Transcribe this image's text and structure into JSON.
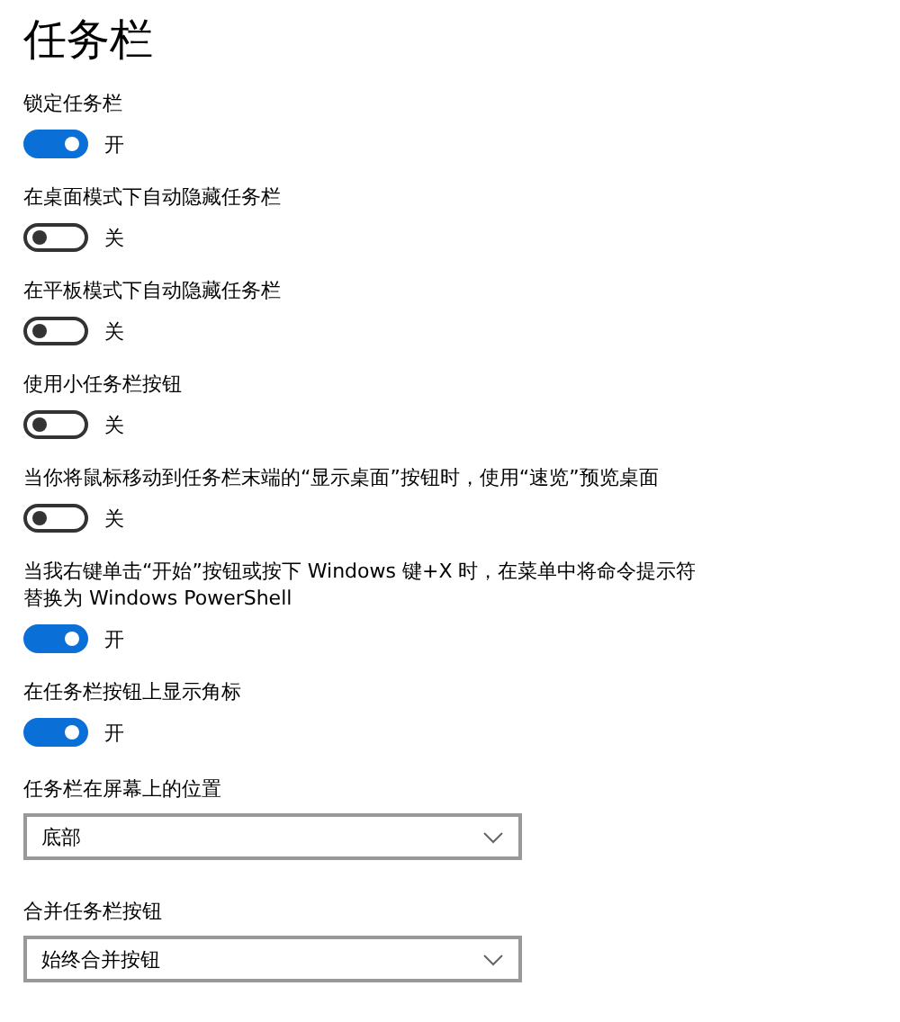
{
  "title": "任务栏",
  "toggles": [
    {
      "label": "锁定任务栏",
      "on": true,
      "state_label": "开"
    },
    {
      "label": "在桌面模式下自动隐藏任务栏",
      "on": false,
      "state_label": "关"
    },
    {
      "label": "在平板模式下自动隐藏任务栏",
      "on": false,
      "state_label": "关"
    },
    {
      "label": "使用小任务栏按钮",
      "on": false,
      "state_label": "关"
    },
    {
      "label": "当你将鼠标移动到任务栏末端的“显示桌面”按钮时，使用“速览”预览桌面",
      "on": false,
      "state_label": "关"
    },
    {
      "label": "当我右键单击“开始”按钮或按下 Windows 键+X 时，在菜单中将命令提示符替换为 Windows PowerShell",
      "on": true,
      "state_label": "开"
    },
    {
      "label": "在任务栏按钮上显示角标",
      "on": true,
      "state_label": "开"
    }
  ],
  "dropdowns": [
    {
      "label": "任务栏在屏幕上的位置",
      "value": "底部"
    },
    {
      "label": "合并任务栏按钮",
      "value": "始终合并按钮"
    }
  ]
}
